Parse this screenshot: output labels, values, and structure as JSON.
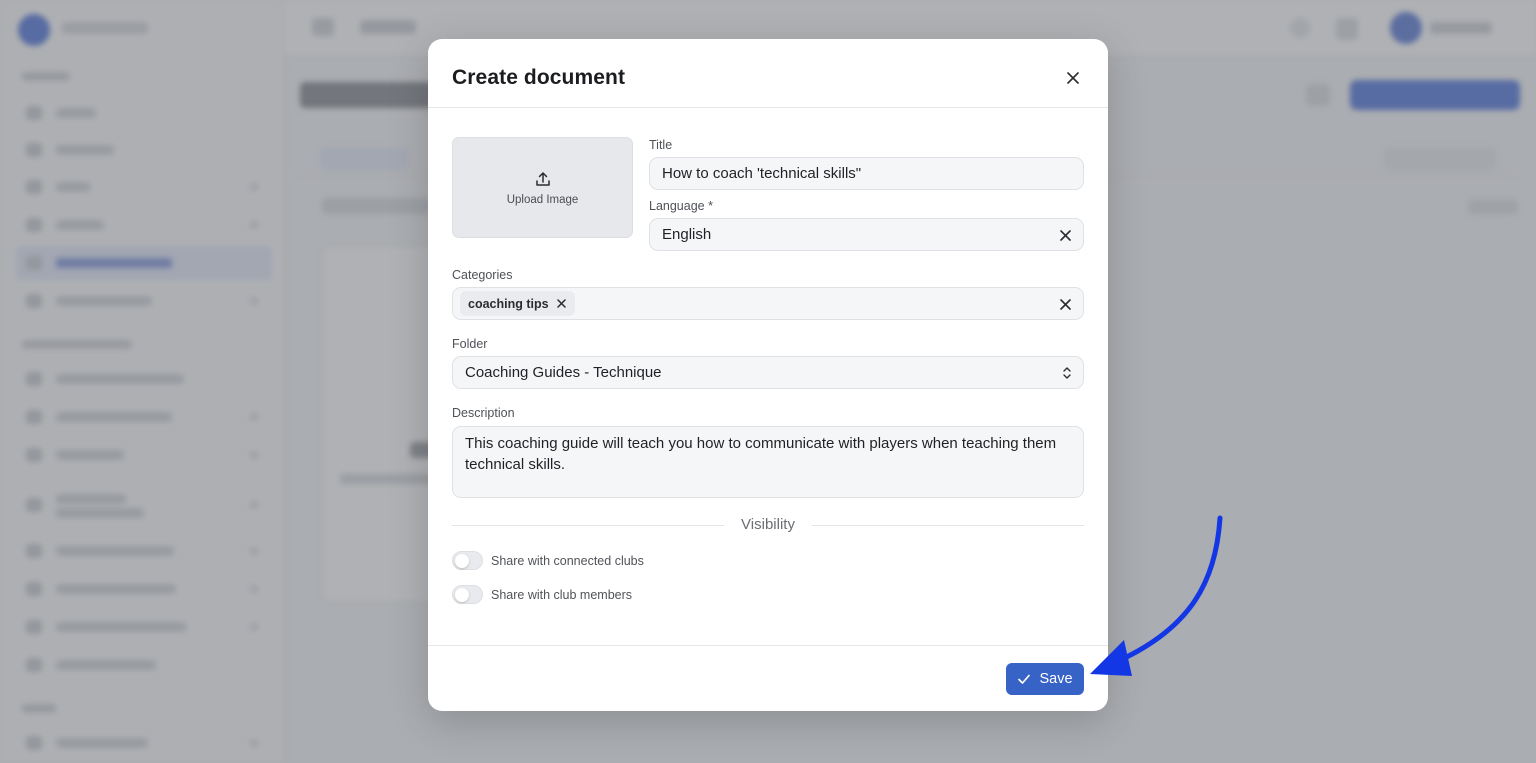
{
  "modal": {
    "title": "Create document",
    "upload_label": "Upload Image",
    "title_label": "Title",
    "title_value": "How to coach 'technical skills\"",
    "language_label": "Language *",
    "language_value": "English",
    "categories_label": "Categories",
    "category_chip": "coaching tips",
    "folder_label": "Folder",
    "folder_value": "Coaching Guides - Technique",
    "description_label": "Description",
    "description_value": "This coaching guide will teach you how to communicate with players when teaching them technical skills.",
    "visibility_label": "Visibility",
    "toggles": [
      {
        "label": "Share with connected clubs",
        "on": false
      },
      {
        "label": "Share with club members",
        "on": false
      }
    ],
    "save_label": "Save"
  },
  "colors": {
    "primary": "#3762c6",
    "annotation_arrow": "#1437e6"
  },
  "icons": [
    "upload-icon",
    "close-icon",
    "chevron-up-down-icon",
    "check-icon"
  ]
}
